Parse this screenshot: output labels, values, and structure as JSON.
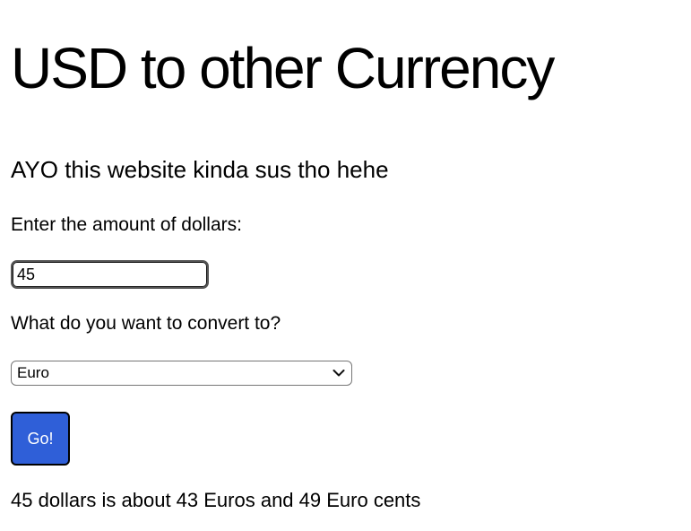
{
  "page": {
    "title": "USD to other Currency",
    "subtitle": "AYO this website kinda sus tho hehe"
  },
  "form": {
    "amount_label": "Enter the amount of dollars:",
    "amount_value": "45",
    "convert_label": "What do you want to convert to?",
    "currency_selected": "Euro",
    "go_label": "Go!"
  },
  "result": {
    "text": "45 dollars is about 43 Euros and 49 Euro cents"
  },
  "colors": {
    "button_bg": "#2f5fd8",
    "button_text": "#ffffff",
    "text": "#000000"
  },
  "icons": {
    "select_arrow": "chevron-down-icon"
  }
}
